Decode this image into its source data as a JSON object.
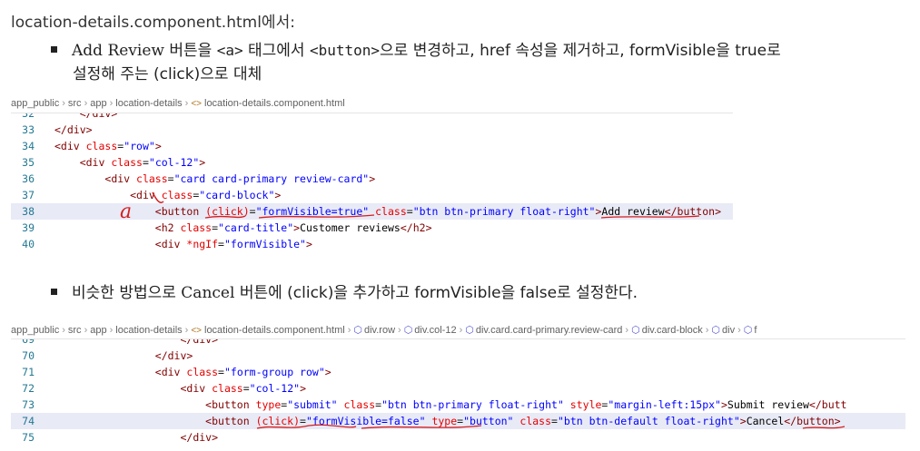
{
  "heading": "location-details.component.html에서:",
  "bullet1": {
    "part_serif": "Add Review",
    "part1": " 버튼을 ",
    "part_mono1": "<a>",
    "part2": " 태그에서 ",
    "part_mono2": "<button>",
    "part3": "으로 변경하고, href 속성을 제거하고, formVisible을 true로",
    "line2": "설정해 주는 (click)으로 대체"
  },
  "bullet2": {
    "part1": "비슷한 방법으로 ",
    "part_serif": "Cancel",
    "part2": " 버튼에 (click)을 추가하고 formVisible을 false로 설정한다."
  },
  "crumb1": [
    "app_public",
    "src",
    "app",
    "location-details",
    "location-details.component.html"
  ],
  "crumb2": [
    "app_public",
    "src",
    "app",
    "location-details",
    "location-details.component.html",
    "div.row",
    "div.col-12",
    "div.card.card-primary.review-card",
    "div.card-block",
    "div",
    "f"
  ],
  "editor1": {
    "lines": [
      {
        "n": "32",
        "text": "    </div>"
      },
      {
        "n": "33",
        "text": "</div>"
      },
      {
        "n": "34",
        "text": "<div class=\"row\">"
      },
      {
        "n": "35",
        "text": "    <div class=\"col-12\">"
      },
      {
        "n": "36",
        "text": "        <div class=\"card card-primary review-card\">"
      },
      {
        "n": "37",
        "text": "            <div class=\"card-block\">"
      },
      {
        "n": "38",
        "text": "                <button (click)=\"formVisible=true\" class=\"btn btn-primary float-right\">Add review</button>"
      },
      {
        "n": "39",
        "text": "                <h2 class=\"card-title\">Customer reviews</h2>"
      },
      {
        "n": "40",
        "text": "                <div *ngIf=\"formVisible\">"
      }
    ]
  },
  "editor2": {
    "lines": [
      {
        "n": "69",
        "text": "                    </div>"
      },
      {
        "n": "70",
        "text": "                </div>"
      },
      {
        "n": "71",
        "text": "                <div class=\"form-group row\">"
      },
      {
        "n": "72",
        "text": "                    <div class=\"col-12\">"
      },
      {
        "n": "73",
        "text": "                        <button type=\"submit\" class=\"btn btn-primary float-right\" style=\"margin-left:15px\">Submit review</butt"
      },
      {
        "n": "74",
        "text": "                        <button (click)=\"formVisible=false\" type=\"button\" class=\"btn btn-default float-right\">Cancel</button>"
      },
      {
        "n": "75",
        "text": "                    </div>"
      }
    ]
  },
  "annotation": "a",
  "colors": {
    "tag": "#800000",
    "attr": "#e50000",
    "value": "#0000ff",
    "linenum": "#237893",
    "highlight": "#e8eaf6",
    "annotation": "#d32020"
  }
}
